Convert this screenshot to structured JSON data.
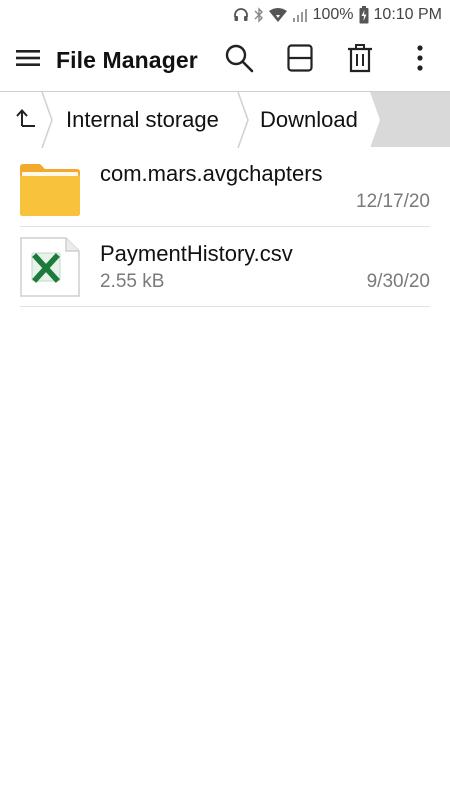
{
  "status_bar": {
    "battery": "100%",
    "time": "10:10 PM",
    "icons": [
      "headphones-icon",
      "bluetooth-icon",
      "wifi-icon",
      "signal-icon",
      "battery-icon"
    ]
  },
  "app_bar": {
    "title": "File Manager",
    "icons": [
      "menu-icon",
      "search-icon",
      "split-view-icon",
      "trash-icon",
      "more-vert-icon"
    ]
  },
  "breadcrumb": {
    "items": [
      "Internal storage",
      "Download"
    ]
  },
  "files": [
    {
      "name": "com.mars.avgchapters",
      "size": "",
      "date": "12/17/20",
      "icon": "folder-icon"
    },
    {
      "name": "PaymentHistory.csv",
      "size": "2.55 kB",
      "date": "9/30/20",
      "icon": "excel-file-icon"
    }
  ],
  "colors": {
    "folder": "#f9c23c",
    "breadcrumb_bg": "#d9d9d9",
    "excel_green": "#1e7a3a",
    "secondary_text": "#7a7a7a"
  }
}
